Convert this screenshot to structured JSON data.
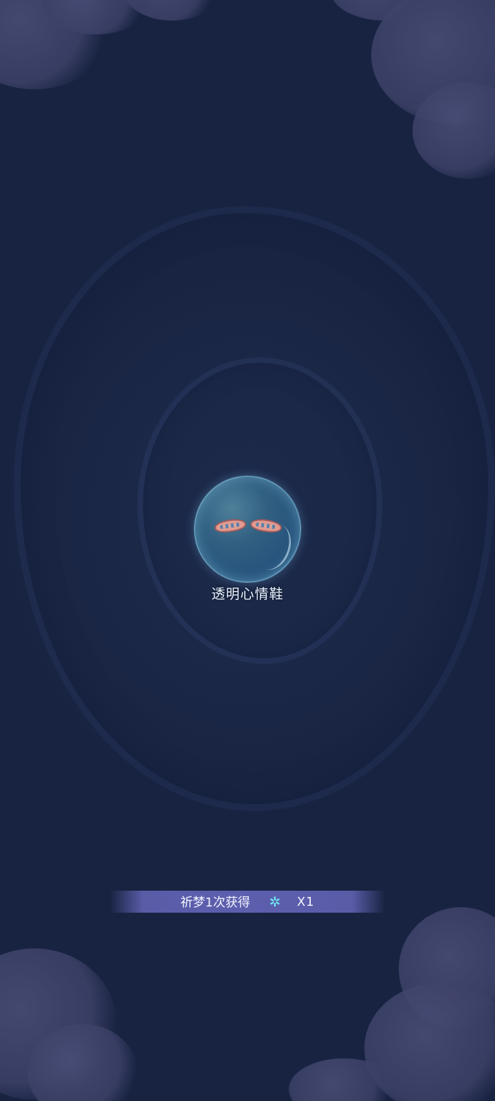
{
  "reward": {
    "item_name": "透明心情鞋",
    "summary_text": "祈梦1次获得",
    "count_text": "X1",
    "currency_icon": "snowflake-gem-icon"
  },
  "colors": {
    "background": "#1b2746",
    "banner": "#5d5fae",
    "currency_icon": "#6fe8f0",
    "item_name_text": "#e8f1ff"
  }
}
